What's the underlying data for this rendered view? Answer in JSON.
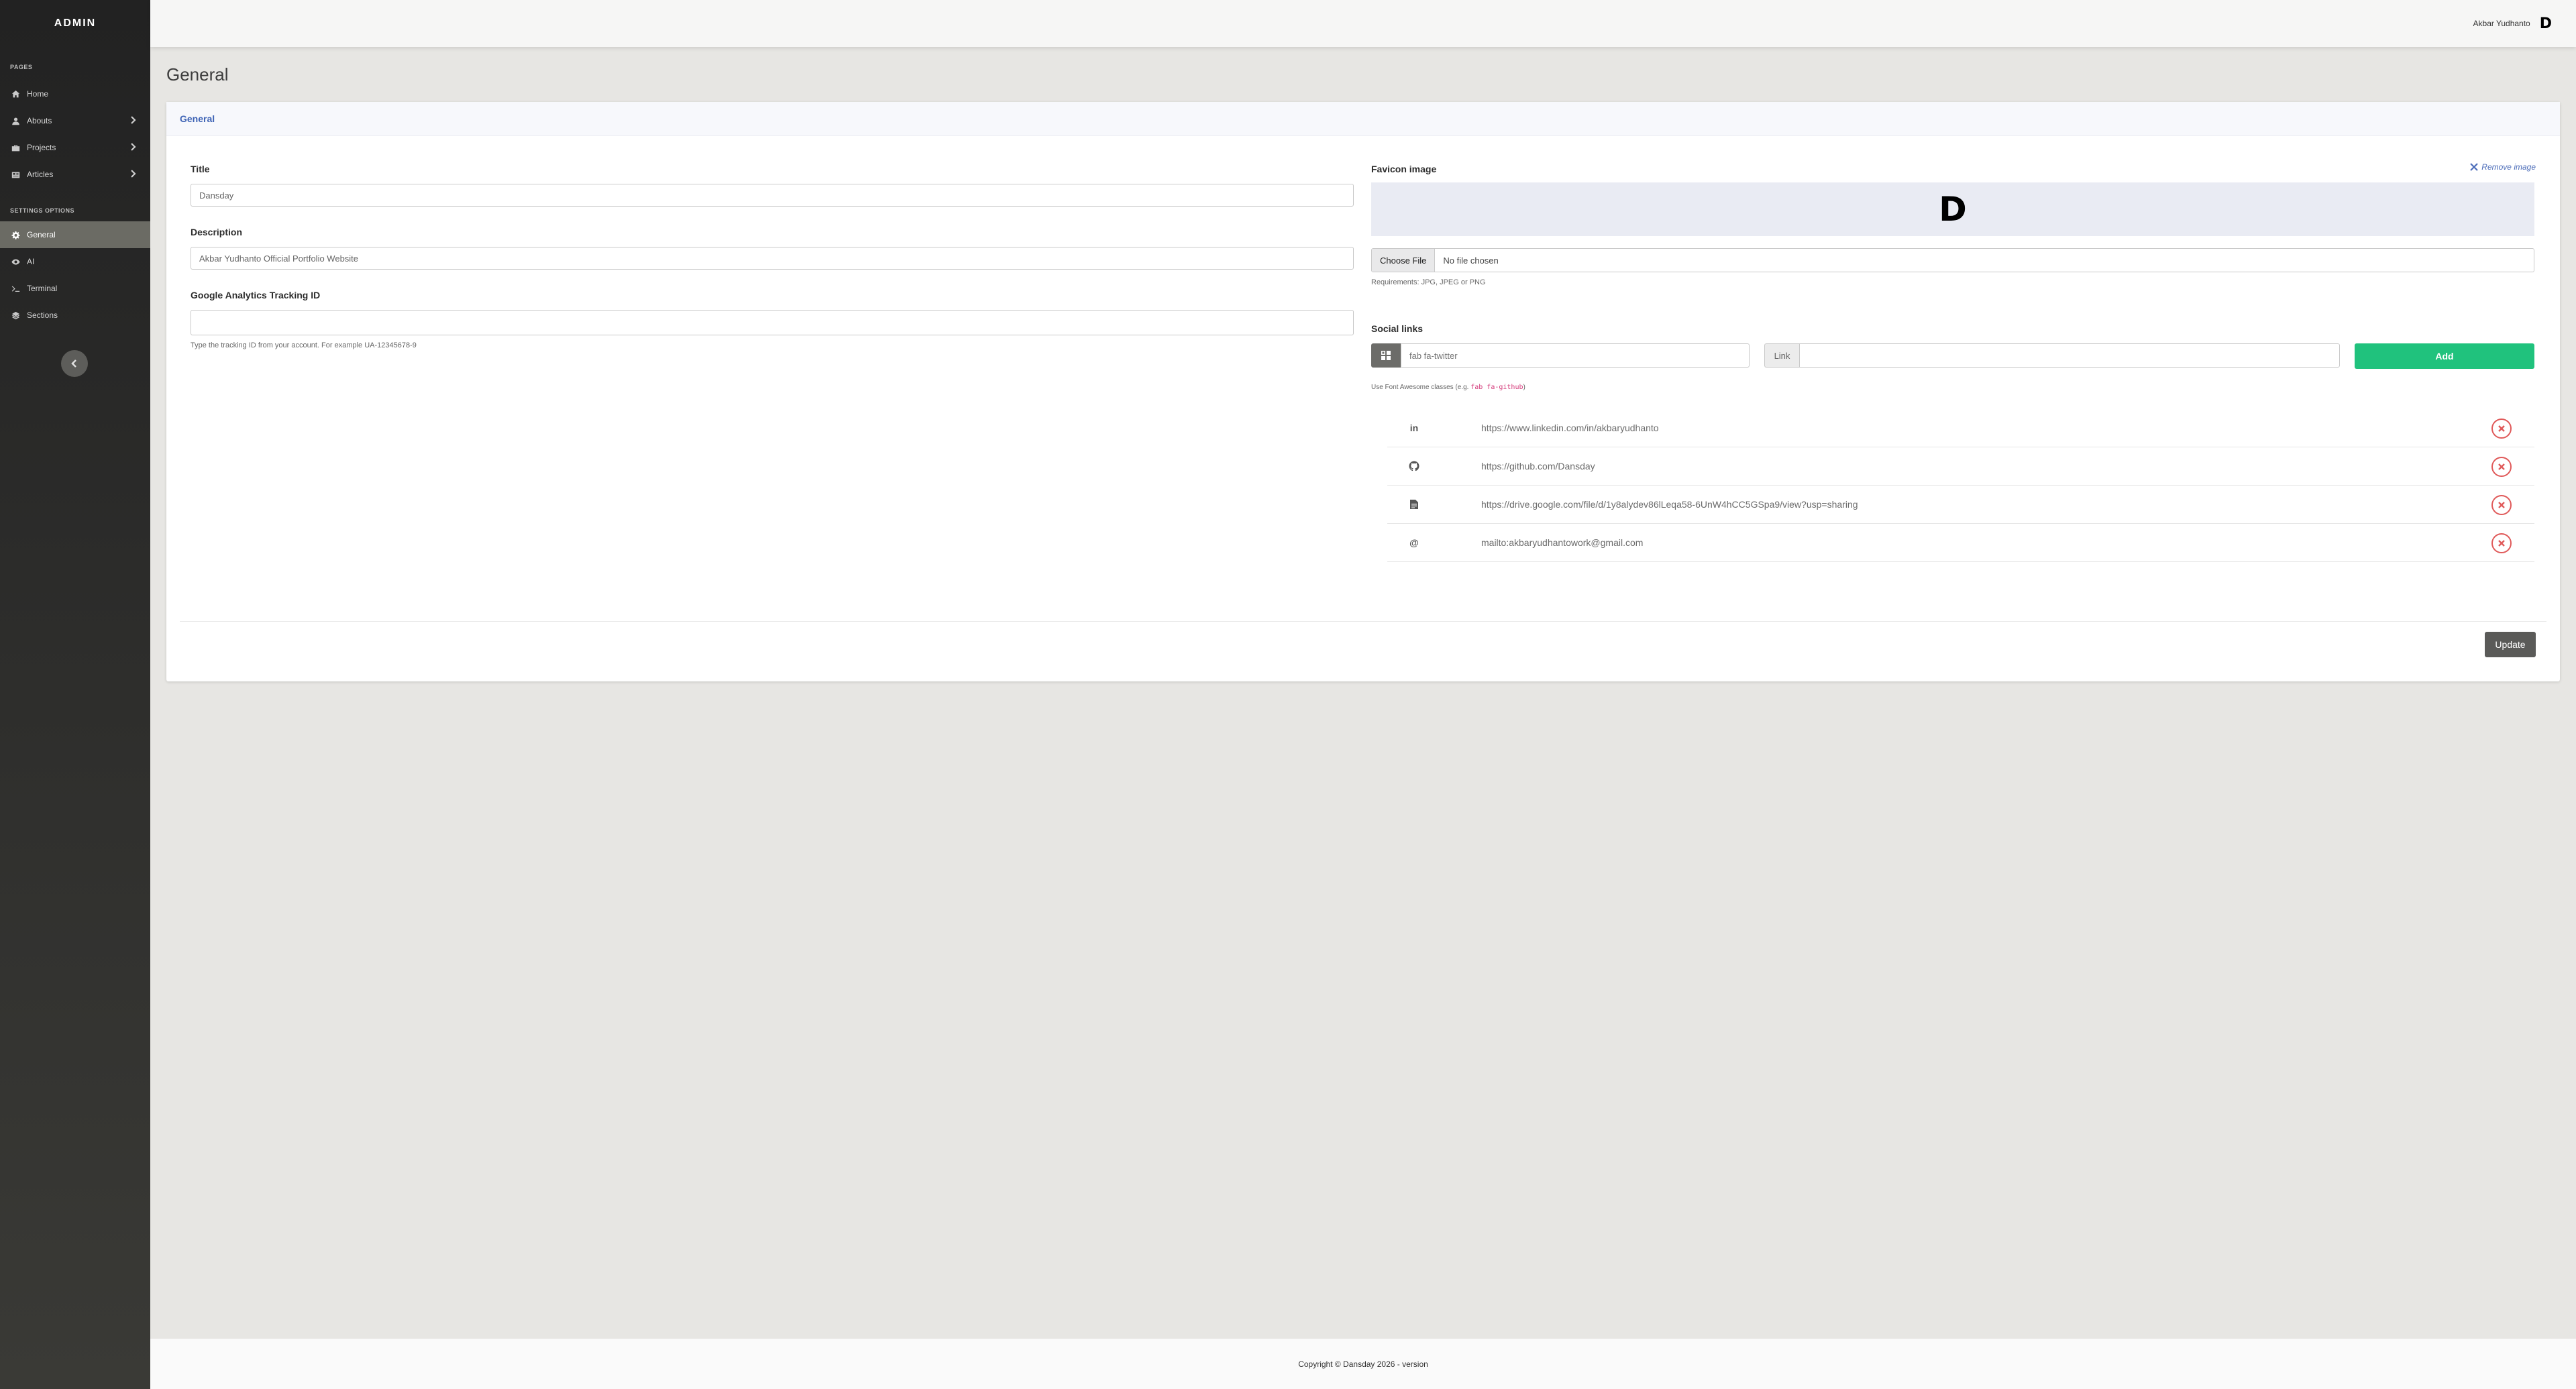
{
  "sidebar": {
    "brand": "ADMIN",
    "pages_heading": "PAGES",
    "pages": [
      {
        "label": "Home",
        "icon": "home-icon"
      },
      {
        "label": "Abouts",
        "icon": "user-icon"
      },
      {
        "label": "Projects",
        "icon": "briefcase-icon"
      },
      {
        "label": "Articles",
        "icon": "newspaper-icon"
      }
    ],
    "settings_heading": "SETTINGS OPTIONS",
    "settings": [
      {
        "label": "General",
        "icon": "gear-icon",
        "active": true
      },
      {
        "label": "AI",
        "icon": "eye-icon"
      },
      {
        "label": "Terminal",
        "icon": "terminal-icon"
      },
      {
        "label": "Sections",
        "icon": "layers-icon"
      }
    ]
  },
  "topbar": {
    "user_name": "Akbar Yudhanto",
    "avatar_letter": "D"
  },
  "page_title": "General",
  "card": {
    "header": "General",
    "title_label": "Title",
    "title_value": "Dansday",
    "description_label": "Description",
    "description_value": "Akbar Yudhanto Official Portfolio Website",
    "ga_label": "Google Analytics Tracking ID",
    "ga_value": "",
    "ga_help": "Type the tracking ID from your account. For example UA-12345678-9",
    "favicon_label": "Favicon image",
    "remove_image": "Remove image",
    "favicon_letter": "D",
    "choose_file": "Choose File",
    "no_file": "No file chosen",
    "requirements": "Requirements: JPG, JPEG or PNG",
    "social_label": "Social links",
    "icon_placeholder": "fab fa-twitter",
    "link_addon": "Link",
    "link_placeholder": "",
    "add_button": "Add",
    "fa_help_prefix": "Use Font Awesome classes (e.g.",
    "fa_help_code": "fab fa-github",
    "fa_help_suffix": ")",
    "social_links": [
      {
        "icon": "linkedin-icon",
        "glyph": "in",
        "url": "https://www.linkedin.com/in/akbaryudhanto"
      },
      {
        "icon": "github-icon",
        "glyph": "",
        "url": "https://github.com/Dansday"
      },
      {
        "icon": "document-icon",
        "glyph": "",
        "url": "https://drive.google.com/file/d/1y8alydev86lLeqa58-6UnW4hCC5GSpa9/view?usp=sharing"
      },
      {
        "icon": "at-icon",
        "glyph": "@",
        "url": "mailto:akbaryudhantowork@gmail.com"
      }
    ],
    "update_button": "Update"
  },
  "footer": {
    "text": "Copyright © Dansday 2026 - version"
  }
}
